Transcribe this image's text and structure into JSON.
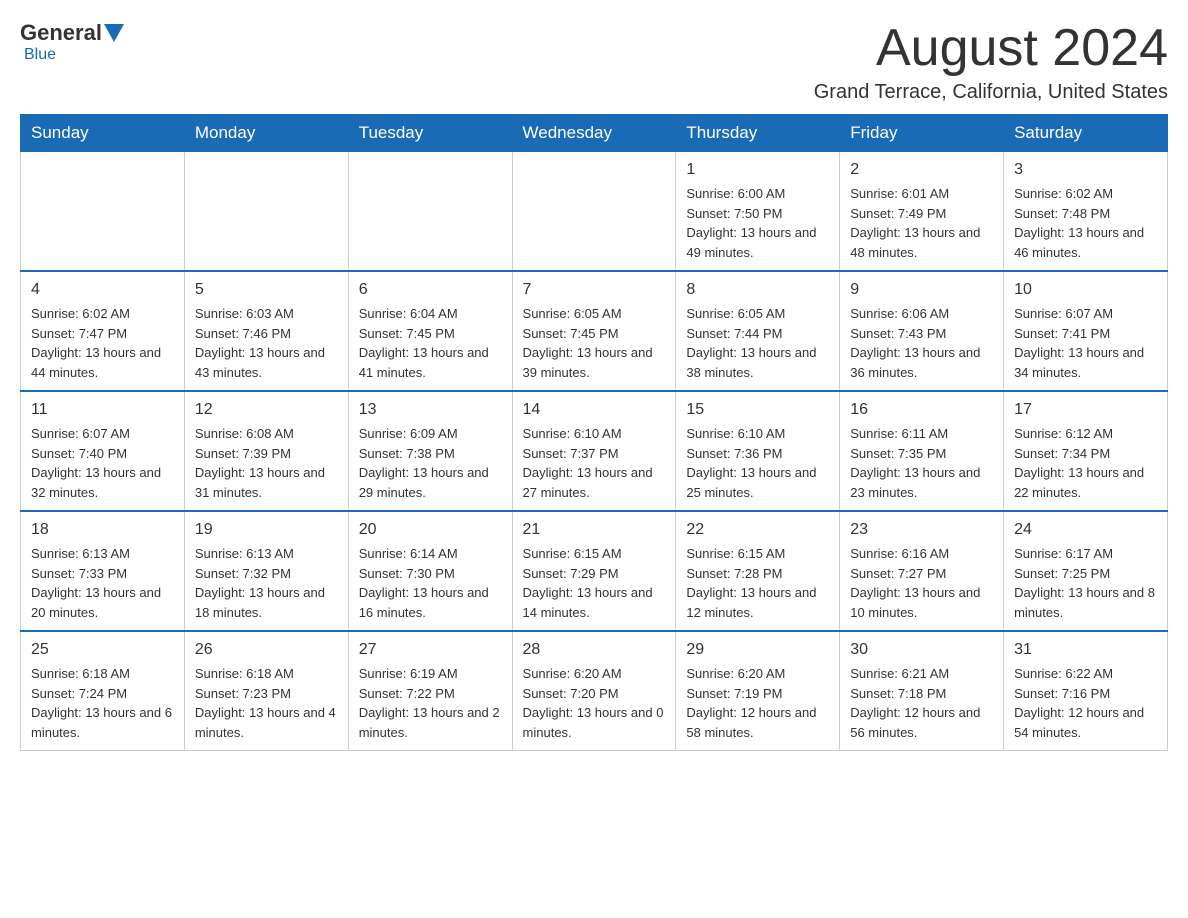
{
  "header": {
    "logo_general": "General",
    "logo_blue": "Blue",
    "month_title": "August 2024",
    "location": "Grand Terrace, California, United States"
  },
  "weekdays": [
    "Sunday",
    "Monday",
    "Tuesday",
    "Wednesday",
    "Thursday",
    "Friday",
    "Saturday"
  ],
  "weeks": [
    [
      {
        "day": "",
        "info": ""
      },
      {
        "day": "",
        "info": ""
      },
      {
        "day": "",
        "info": ""
      },
      {
        "day": "",
        "info": ""
      },
      {
        "day": "1",
        "info": "Sunrise: 6:00 AM\nSunset: 7:50 PM\nDaylight: 13 hours and 49 minutes."
      },
      {
        "day": "2",
        "info": "Sunrise: 6:01 AM\nSunset: 7:49 PM\nDaylight: 13 hours and 48 minutes."
      },
      {
        "day": "3",
        "info": "Sunrise: 6:02 AM\nSunset: 7:48 PM\nDaylight: 13 hours and 46 minutes."
      }
    ],
    [
      {
        "day": "4",
        "info": "Sunrise: 6:02 AM\nSunset: 7:47 PM\nDaylight: 13 hours and 44 minutes."
      },
      {
        "day": "5",
        "info": "Sunrise: 6:03 AM\nSunset: 7:46 PM\nDaylight: 13 hours and 43 minutes."
      },
      {
        "day": "6",
        "info": "Sunrise: 6:04 AM\nSunset: 7:45 PM\nDaylight: 13 hours and 41 minutes."
      },
      {
        "day": "7",
        "info": "Sunrise: 6:05 AM\nSunset: 7:45 PM\nDaylight: 13 hours and 39 minutes."
      },
      {
        "day": "8",
        "info": "Sunrise: 6:05 AM\nSunset: 7:44 PM\nDaylight: 13 hours and 38 minutes."
      },
      {
        "day": "9",
        "info": "Sunrise: 6:06 AM\nSunset: 7:43 PM\nDaylight: 13 hours and 36 minutes."
      },
      {
        "day": "10",
        "info": "Sunrise: 6:07 AM\nSunset: 7:41 PM\nDaylight: 13 hours and 34 minutes."
      }
    ],
    [
      {
        "day": "11",
        "info": "Sunrise: 6:07 AM\nSunset: 7:40 PM\nDaylight: 13 hours and 32 minutes."
      },
      {
        "day": "12",
        "info": "Sunrise: 6:08 AM\nSunset: 7:39 PM\nDaylight: 13 hours and 31 minutes."
      },
      {
        "day": "13",
        "info": "Sunrise: 6:09 AM\nSunset: 7:38 PM\nDaylight: 13 hours and 29 minutes."
      },
      {
        "day": "14",
        "info": "Sunrise: 6:10 AM\nSunset: 7:37 PM\nDaylight: 13 hours and 27 minutes."
      },
      {
        "day": "15",
        "info": "Sunrise: 6:10 AM\nSunset: 7:36 PM\nDaylight: 13 hours and 25 minutes."
      },
      {
        "day": "16",
        "info": "Sunrise: 6:11 AM\nSunset: 7:35 PM\nDaylight: 13 hours and 23 minutes."
      },
      {
        "day": "17",
        "info": "Sunrise: 6:12 AM\nSunset: 7:34 PM\nDaylight: 13 hours and 22 minutes."
      }
    ],
    [
      {
        "day": "18",
        "info": "Sunrise: 6:13 AM\nSunset: 7:33 PM\nDaylight: 13 hours and 20 minutes."
      },
      {
        "day": "19",
        "info": "Sunrise: 6:13 AM\nSunset: 7:32 PM\nDaylight: 13 hours and 18 minutes."
      },
      {
        "day": "20",
        "info": "Sunrise: 6:14 AM\nSunset: 7:30 PM\nDaylight: 13 hours and 16 minutes."
      },
      {
        "day": "21",
        "info": "Sunrise: 6:15 AM\nSunset: 7:29 PM\nDaylight: 13 hours and 14 minutes."
      },
      {
        "day": "22",
        "info": "Sunrise: 6:15 AM\nSunset: 7:28 PM\nDaylight: 13 hours and 12 minutes."
      },
      {
        "day": "23",
        "info": "Sunrise: 6:16 AM\nSunset: 7:27 PM\nDaylight: 13 hours and 10 minutes."
      },
      {
        "day": "24",
        "info": "Sunrise: 6:17 AM\nSunset: 7:25 PM\nDaylight: 13 hours and 8 minutes."
      }
    ],
    [
      {
        "day": "25",
        "info": "Sunrise: 6:18 AM\nSunset: 7:24 PM\nDaylight: 13 hours and 6 minutes."
      },
      {
        "day": "26",
        "info": "Sunrise: 6:18 AM\nSunset: 7:23 PM\nDaylight: 13 hours and 4 minutes."
      },
      {
        "day": "27",
        "info": "Sunrise: 6:19 AM\nSunset: 7:22 PM\nDaylight: 13 hours and 2 minutes."
      },
      {
        "day": "28",
        "info": "Sunrise: 6:20 AM\nSunset: 7:20 PM\nDaylight: 13 hours and 0 minutes."
      },
      {
        "day": "29",
        "info": "Sunrise: 6:20 AM\nSunset: 7:19 PM\nDaylight: 12 hours and 58 minutes."
      },
      {
        "day": "30",
        "info": "Sunrise: 6:21 AM\nSunset: 7:18 PM\nDaylight: 12 hours and 56 minutes."
      },
      {
        "day": "31",
        "info": "Sunrise: 6:22 AM\nSunset: 7:16 PM\nDaylight: 12 hours and 54 minutes."
      }
    ]
  ]
}
